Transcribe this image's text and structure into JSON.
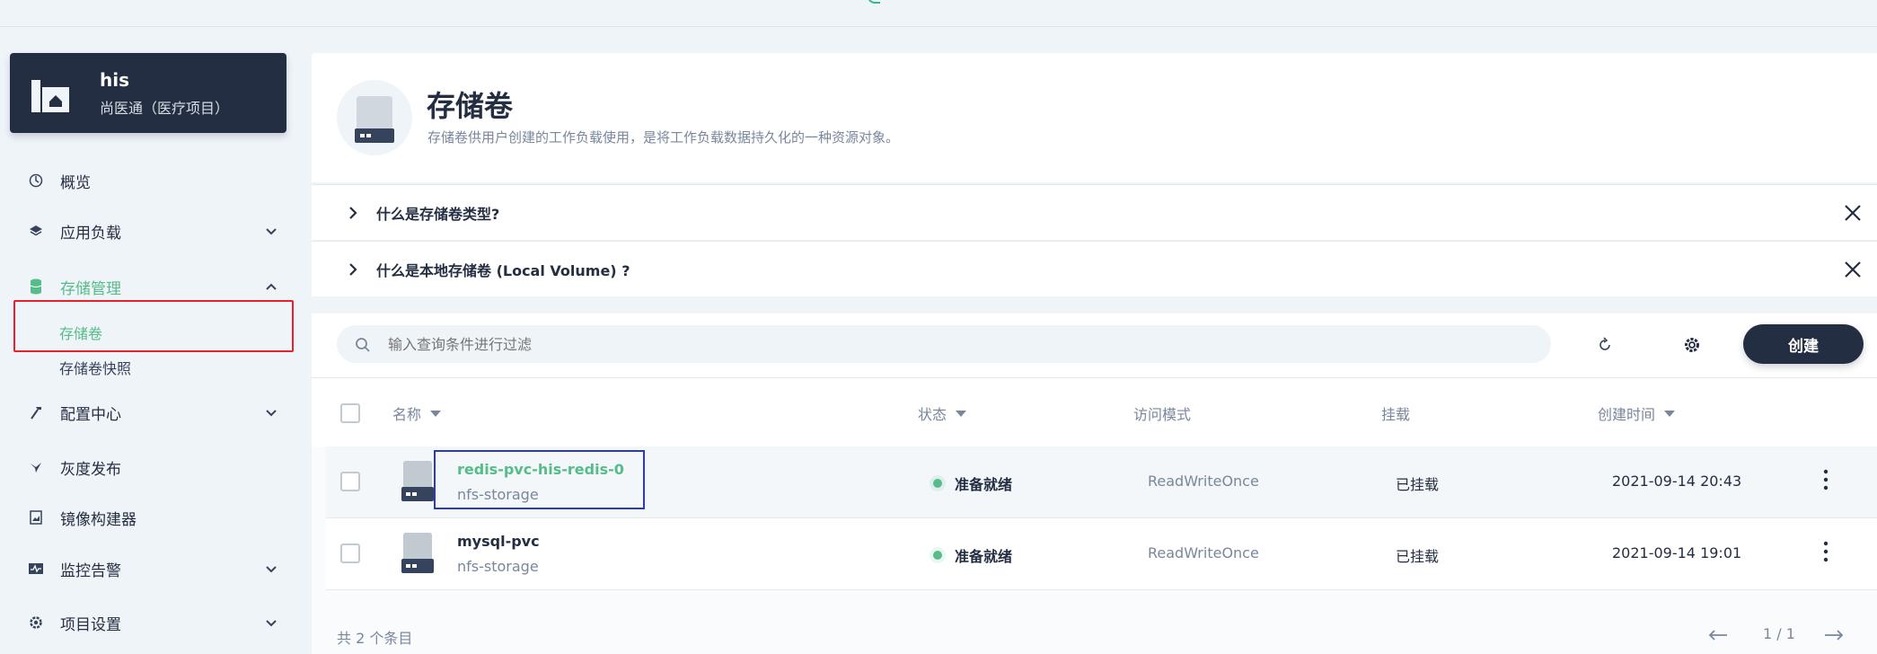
{
  "project": {
    "name": "his",
    "description": "尚医通（医疗项目）"
  },
  "sidebar": {
    "items": [
      {
        "label": "概览",
        "icon": "dashboard-icon"
      },
      {
        "label": "应用负载",
        "icon": "layers-icon"
      },
      {
        "label": "存储管理",
        "icon": "database-icon"
      },
      {
        "label": "配置中心",
        "icon": "hammer-icon"
      },
      {
        "label": "灰度发布",
        "icon": "bird-icon"
      },
      {
        "label": "镜像构建器",
        "icon": "image-builder-icon"
      },
      {
        "label": "监控告警",
        "icon": "monitor-icon"
      },
      {
        "label": "项目设置",
        "icon": "gear-icon"
      }
    ],
    "storage_sub": [
      "存储卷",
      "存储卷快照"
    ]
  },
  "header": {
    "title": "存储卷",
    "description": "存储卷供用户创建的工作负载使用，是将工作负载数据持久化的一种资源对象。"
  },
  "faq": [
    "什么是存储卷类型?",
    "什么是本地存储卷 (Local Volume) ?"
  ],
  "toolbar": {
    "search_placeholder": "输入查询条件进行过滤",
    "create_label": "创建"
  },
  "table": {
    "columns": [
      "名称",
      "状态",
      "访问模式",
      "挂载",
      "创建时间"
    ],
    "rows": [
      {
        "name": "redis-pvc-his-redis-0",
        "storage_class": "nfs-storage",
        "status": "准备就绪",
        "access_mode": "ReadWriteOnce",
        "mount": "已挂载",
        "created": "2021-09-14 20:43"
      },
      {
        "name": "mysql-pvc",
        "storage_class": "nfs-storage",
        "status": "准备就绪",
        "access_mode": "ReadWriteOnce",
        "mount": "已挂载",
        "created": "2021-09-14 19:01"
      }
    ]
  },
  "footer": {
    "count": "共 2 个条目",
    "page": "1 / 1"
  },
  "colors": {
    "accent": "#55bc8a",
    "dark": "#242e42",
    "highlight_red": "#e8202a",
    "highlight_blue": "#2a3bb5"
  }
}
